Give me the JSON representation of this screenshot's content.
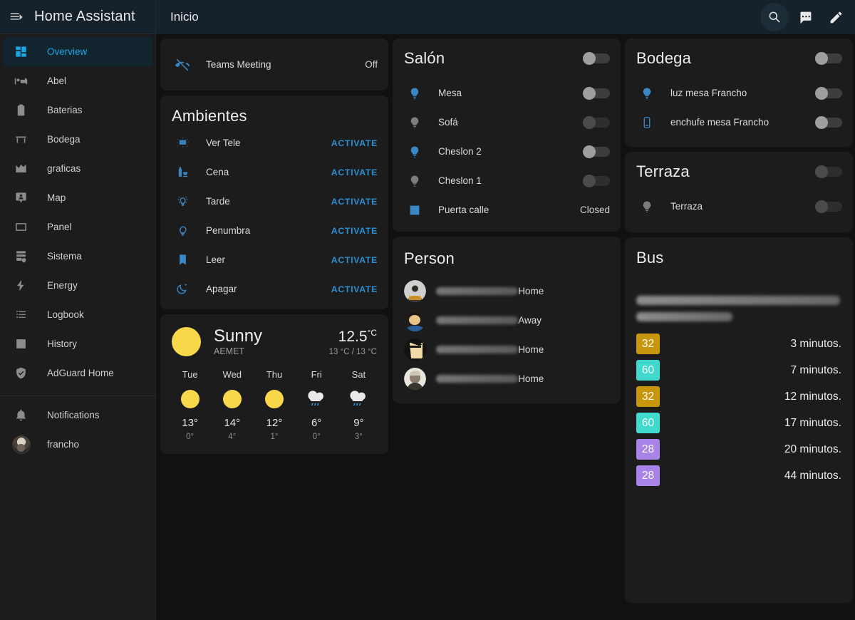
{
  "sidebar": {
    "app_title": "Home Assistant",
    "menu_icon": "menu-collapse-icon",
    "items": [
      {
        "label": "Overview",
        "icon": "view-dashboard-icon",
        "active": true
      },
      {
        "label": "Abel",
        "icon": "bed-icon",
        "active": false
      },
      {
        "label": "Baterias",
        "icon": "battery-icon",
        "active": false
      },
      {
        "label": "Bodega",
        "icon": "table-furniture-icon",
        "active": false
      },
      {
        "label": "graficas",
        "icon": "chart-areaspline-icon",
        "active": false
      },
      {
        "label": "Map",
        "icon": "map-marker-account-icon",
        "active": false
      },
      {
        "label": "Panel",
        "icon": "rectangle-outline-icon",
        "active": false
      },
      {
        "label": "Sistema",
        "icon": "server-security-icon",
        "active": false
      },
      {
        "label": "Energy",
        "icon": "lightning-bolt-icon",
        "active": false
      },
      {
        "label": "Logbook",
        "icon": "format-list-bulleted-icon",
        "active": false
      },
      {
        "label": "History",
        "icon": "chart-box-icon",
        "active": false
      },
      {
        "label": "AdGuard Home",
        "icon": "shield-check-icon",
        "active": false
      }
    ],
    "footer": [
      {
        "label": "Notifications",
        "icon": "bell-icon"
      },
      {
        "label": "francho",
        "icon": "user-avatar"
      }
    ]
  },
  "topbar": {
    "view_title": "Inicio",
    "actions": [
      {
        "name": "search-icon",
        "highlighted": true
      },
      {
        "name": "assist-chat-icon",
        "highlighted": false
      },
      {
        "name": "edit-pencil-icon",
        "highlighted": false
      }
    ]
  },
  "teams_card": {
    "icon": "phone-hangup-icon",
    "name": "Teams Meeting",
    "state": "Off"
  },
  "ambientes": {
    "title": "Ambientes",
    "scenes": [
      {
        "name": "Ver Tele",
        "icon": "television-shimmer-icon",
        "action": "ACTIVATE"
      },
      {
        "name": "Cena",
        "icon": "bottle-food-icon",
        "action": "ACTIVATE"
      },
      {
        "name": "Tarde",
        "icon": "lightbulb-on-icon",
        "action": "ACTIVATE"
      },
      {
        "name": "Penumbra",
        "icon": "lightbulb-outline-icon",
        "action": "ACTIVATE"
      },
      {
        "name": "Leer",
        "icon": "book-icon",
        "action": "ACTIVATE"
      },
      {
        "name": "Apagar",
        "icon": "weather-night-icon",
        "action": "ACTIVATE"
      }
    ]
  },
  "weather": {
    "condition": "Sunny",
    "attribution": "AEMET",
    "temperature": "12.5",
    "temperature_unit": "°C",
    "range": "13 °C / 13 °C",
    "icon": "weather-sunny-icon",
    "forecast": [
      {
        "day": "Tue",
        "icon": "weather-sunny-icon",
        "high": "13°",
        "low": "0°"
      },
      {
        "day": "Wed",
        "icon": "weather-sunny-icon",
        "high": "14°",
        "low": "4°"
      },
      {
        "day": "Thu",
        "icon": "weather-sunny-icon",
        "high": "12°",
        "low": "1°"
      },
      {
        "day": "Fri",
        "icon": "weather-rainy-icon",
        "high": "6°",
        "low": "0°"
      },
      {
        "day": "Sat",
        "icon": "weather-rainy-icon",
        "high": "9°",
        "low": "3°"
      }
    ]
  },
  "salon": {
    "title": "Salón",
    "header_toggle": {
      "on": false,
      "dim": false
    },
    "entities": [
      {
        "name": "Mesa",
        "icon": "lightbulb-icon",
        "icon_active": true,
        "control": "toggle",
        "toggle": {
          "on": false,
          "dim": false
        }
      },
      {
        "name": "Sofá",
        "icon": "lightbulb-icon",
        "icon_active": false,
        "control": "toggle",
        "toggle": {
          "on": false,
          "dim": true
        }
      },
      {
        "name": "Cheslon 2",
        "icon": "lightbulb-icon",
        "icon_active": true,
        "control": "toggle",
        "toggle": {
          "on": false,
          "dim": false
        }
      },
      {
        "name": "Cheslon 1",
        "icon": "lightbulb-icon",
        "icon_active": false,
        "control": "toggle",
        "toggle": {
          "on": false,
          "dim": true
        }
      },
      {
        "name": "Puerta calle",
        "icon": "window-closed-icon",
        "icon_active": true,
        "control": "state",
        "state": "Closed"
      }
    ]
  },
  "person": {
    "title": "Person",
    "people": [
      {
        "name_redacted": true,
        "state": "Home",
        "avatar": "person-avatar-1"
      },
      {
        "name_redacted": true,
        "state": "Away",
        "avatar": "person-avatar-2"
      },
      {
        "name_redacted": true,
        "state": "Home",
        "avatar": "person-avatar-3"
      },
      {
        "name_redacted": true,
        "state": "Home",
        "avatar": "person-avatar-4"
      }
    ]
  },
  "bodega": {
    "title": "Bodega",
    "header_toggle": {
      "on": false,
      "dim": false
    },
    "entities": [
      {
        "name": "luz mesa Francho",
        "icon": "lightbulb-icon",
        "icon_active": true,
        "toggle": {
          "on": false,
          "dim": false
        }
      },
      {
        "name": "enchufe mesa Francho",
        "icon": "power-socket-icon",
        "icon_active": true,
        "toggle": {
          "on": false,
          "dim": false
        }
      }
    ]
  },
  "terraza": {
    "title": "Terraza",
    "header_toggle": {
      "on": false,
      "dim": true
    },
    "entities": [
      {
        "name": "Terraza",
        "icon": "lightbulb-icon",
        "icon_active": false,
        "toggle": {
          "on": false,
          "dim": true
        }
      }
    ]
  },
  "bus": {
    "title": "Bus",
    "line_redacted": true,
    "departures": [
      {
        "line": "32",
        "color": "#c8960c",
        "when": "3 minutos."
      },
      {
        "line": "60",
        "color": "#3fd9ce",
        "when": "7 minutos."
      },
      {
        "line": "32",
        "color": "#c8960c",
        "when": "12 minutos."
      },
      {
        "line": "60",
        "color": "#3fd9ce",
        "when": "17 minutos."
      },
      {
        "line": "28",
        "color": "#a884e8",
        "when": "20 minutos."
      },
      {
        "line": "28",
        "color": "#a884e8",
        "when": "44 minutos."
      }
    ]
  },
  "theme": {
    "accent": "#03a9f4",
    "activate_link": "#2b8fd4",
    "page_bg": "#111111",
    "card_bg": "#1c1c1c",
    "header_bg": "#15212b",
    "sun_yellow": "#f9d74b"
  }
}
